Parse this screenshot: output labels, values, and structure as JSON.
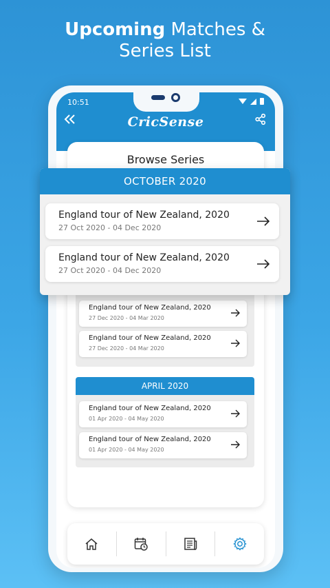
{
  "promo": {
    "headline_bold": "Upcoming",
    "headline_rest": "Matches &",
    "headline_line2": "Series List"
  },
  "status_bar": {
    "time": "10:51"
  },
  "app": {
    "brand": "CricSense"
  },
  "browse": {
    "title": "Browse Series"
  },
  "popup": {
    "month": "OCTOBER 2020",
    "items": [
      {
        "title": "England tour of New Zealand, 2020",
        "dates": "27 Oct 2020 - 04 Dec 2020"
      },
      {
        "title": "England tour of New Zealand, 2020",
        "dates": "27 Oct 2020 - 04 Dec 2020"
      }
    ]
  },
  "months": [
    {
      "items": [
        {
          "title": "England tour of New Zealand, 2020",
          "dates": "27 Dec 2020 - 04 Mar 2020"
        },
        {
          "title": "England tour of New Zealand, 2020",
          "dates": "27 Dec 2020 - 04 Mar 2020"
        }
      ]
    },
    {
      "month": "APRIL 2020",
      "items": [
        {
          "title": "England tour of New Zealand, 2020",
          "dates": "01 Apr 2020 - 04 May 2020"
        },
        {
          "title": "England tour of New Zealand, 2020",
          "dates": "01 Apr 2020 - 04 May 2020"
        }
      ]
    }
  ],
  "icons": {
    "back": "double-chevron-left-icon",
    "share": "share-icon",
    "arrow": "arrow-right-icon",
    "nav": [
      "home-icon",
      "calendar-clock-icon",
      "news-icon",
      "gear-icon"
    ]
  },
  "colors": {
    "accent": "#1f8ed0",
    "active_nav": "#1f8ed0"
  }
}
